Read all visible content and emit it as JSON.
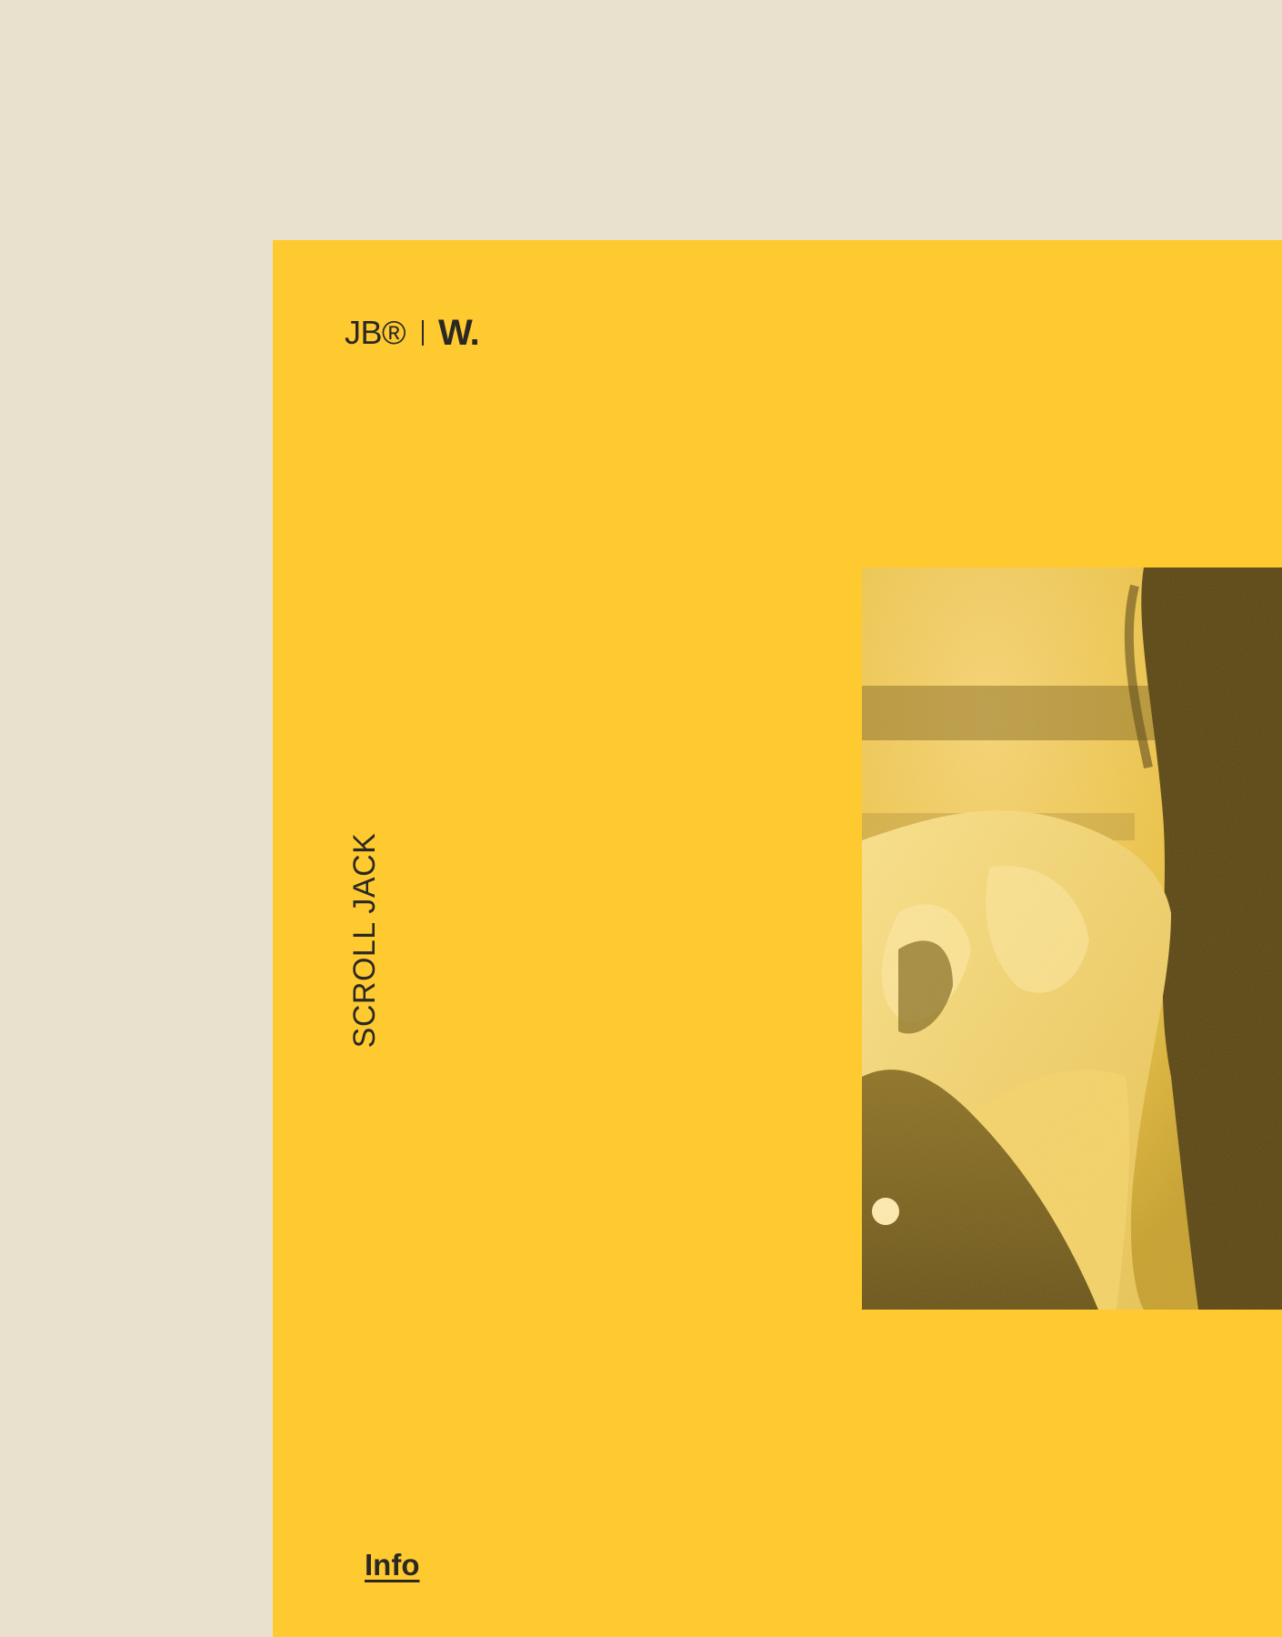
{
  "brand": {
    "mark": "JB®",
    "studio": "W."
  },
  "side_label": "SCROLL JACK",
  "hero": {
    "alt": "Bearded man in a fur-lined jacket, yellow monotone photo"
  },
  "nav": {
    "info_label": "Info"
  },
  "colors": {
    "background": "#e9e1cd",
    "accent_yellow": "#ffca2f",
    "ink": "#2b2824"
  }
}
